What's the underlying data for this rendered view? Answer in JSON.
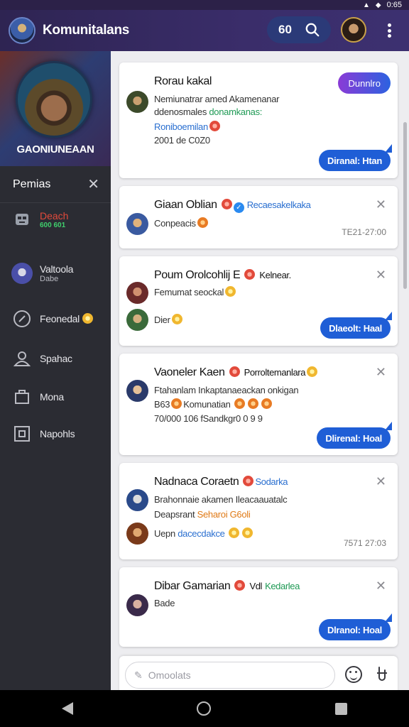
{
  "status_bar": {
    "time": "0:65"
  },
  "app_bar": {
    "title": "Komunitalans",
    "search_count": "60",
    "colors": {
      "bar": "#2e2452",
      "pill": "#2b3a78"
    }
  },
  "sidebar": {
    "hero_name": "GAONIUNEAAN",
    "section_title": "Pemias",
    "items": [
      {
        "label": "Deach",
        "sub": "600 601"
      },
      {
        "label": "Valtoola",
        "sub": "Dabe"
      },
      {
        "label": "Feonedal"
      },
      {
        "label": "Spahac"
      },
      {
        "label": "Mona"
      },
      {
        "label": "Napohls"
      }
    ]
  },
  "feed": {
    "cards": [
      {
        "title": "Rorau kakal",
        "lines": [
          "Nemiunatrar amed Akamenanar",
          "ddenosmales",
          "donamkanas:",
          "Roniboemilan",
          "2001 de C0Z0"
        ],
        "badge": "Dunnlro",
        "reply": "Diranal: Htan"
      },
      {
        "title": "Giaan Oblian",
        "tag": "Recaesakelkaka",
        "lines": [
          "Conpeacis"
        ],
        "timestamp": "TE21-27:00"
      },
      {
        "title": "Poum Orolcohlij E",
        "tag": "Kelnear.",
        "lines": [
          "Femumat seockal",
          "Dier"
        ],
        "reply": "Dlaeolt: Haal"
      },
      {
        "title": "Vaoneler Kaen",
        "tag": "Porroltemanlara",
        "lines": [
          "Ftahanlam Inkaptanaeackan onkigan",
          "B63",
          "Komunatian",
          "70/000 106 fSandkgr0 0 9 9"
        ],
        "reply": "Dlirenal: Hoal"
      },
      {
        "title": "Nadnaca Coraetn",
        "tag": "Sodarka",
        "lines": [
          "Brahonnaie akamen Ileacaauatalc",
          "Deapsrant",
          "Seharoi G6oli",
          "Uepn",
          "dacecdakce"
        ],
        "timestamp": "7571 27:03"
      },
      {
        "title": "Dibar Gamarian",
        "tag": "Vdl",
        "tag2": "Kedarlea",
        "lines": [
          "Bade"
        ],
        "reply": "Dlranol: Hoal"
      }
    ]
  },
  "composer": {
    "placeholder": "Omoolats"
  }
}
